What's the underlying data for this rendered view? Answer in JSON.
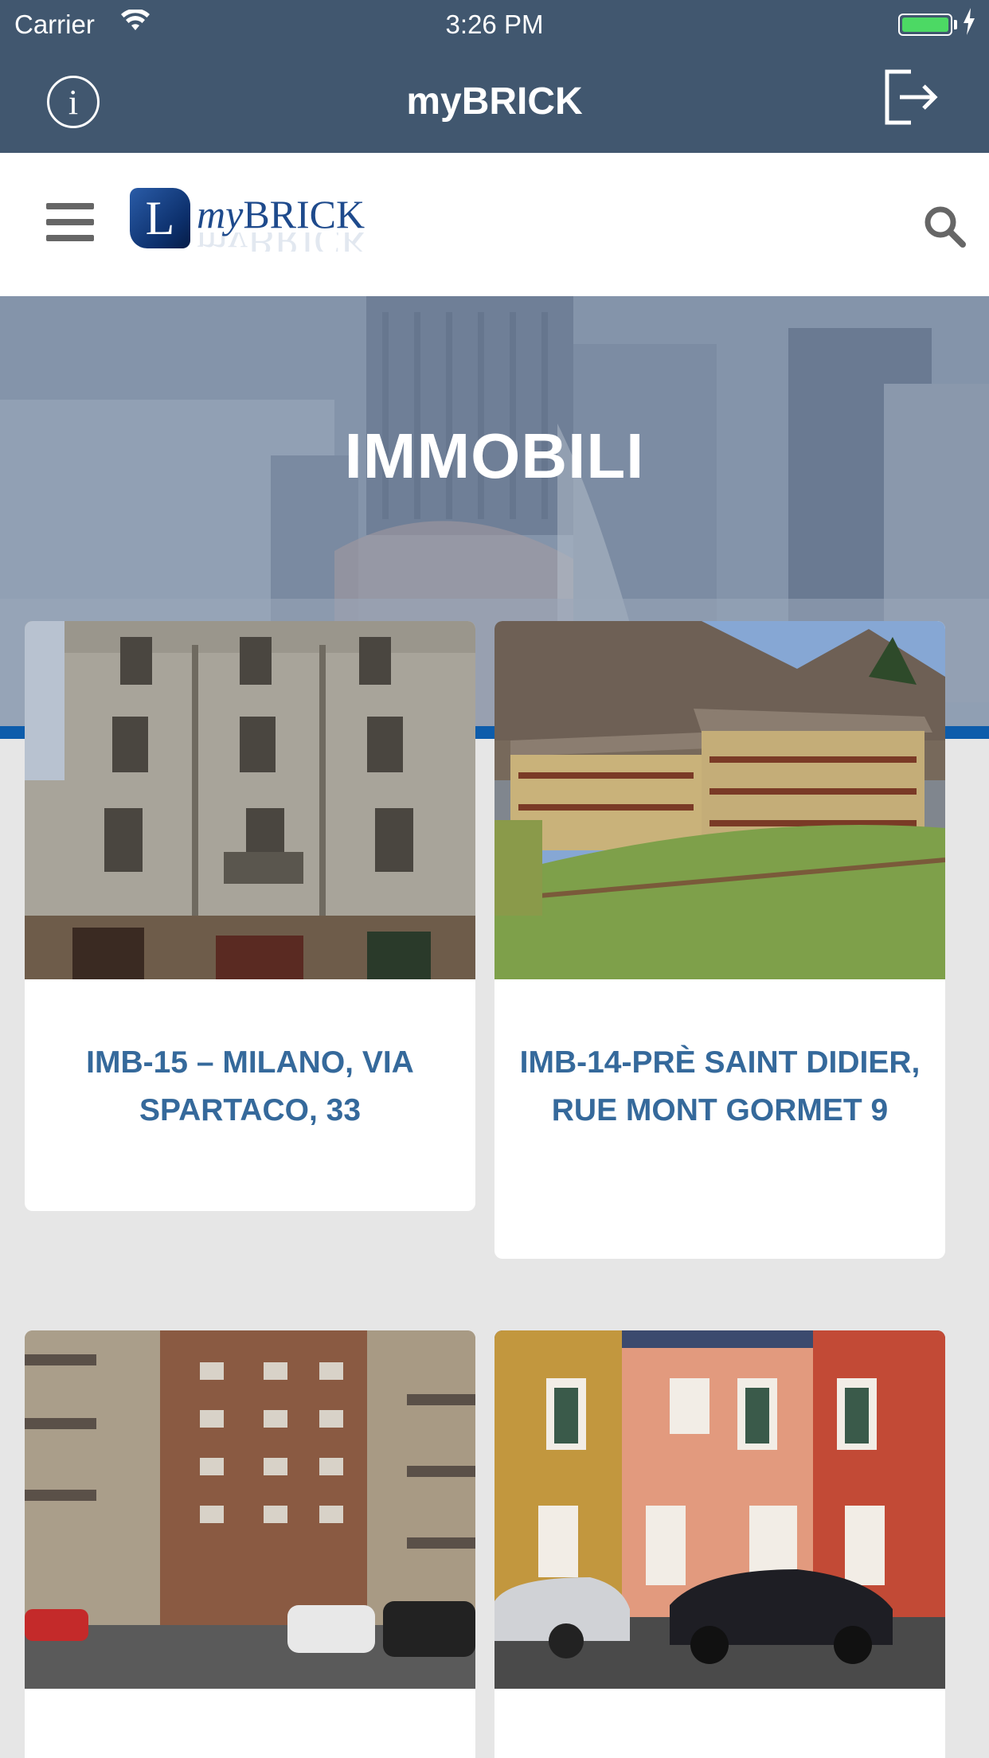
{
  "status_bar": {
    "carrier": "Carrier",
    "time": "3:26 PM",
    "battery_color": "#4cd964"
  },
  "nav_bar": {
    "title": "myBRICK",
    "info_icon": "info-circle-icon",
    "logout_icon": "logout-icon",
    "info_glyph": "i",
    "background": "#41576f"
  },
  "header": {
    "logo_mark": "L",
    "logo_text_my": "my",
    "logo_text_brick": "BRICK",
    "menu_icon": "hamburger-icon",
    "search_icon": "search-icon"
  },
  "hero": {
    "title": "IMMOBILI",
    "stripe_color": "#0d5cab"
  },
  "properties": [
    {
      "title": "IMB-15 – MILANO, VIA SPARTACO, 33",
      "photo": "grey-apartment-building-sushi-bar"
    },
    {
      "title": "IMB-14-PRÈ SAINT DIDIER, RUE MONT GORMET 9",
      "photo": "alpine-chalet-building-mountains"
    },
    {
      "title": "",
      "photo": "brick-apartment-block-parked-cars"
    },
    {
      "title": "",
      "photo": "orange-townhouses-parked-cars"
    }
  ],
  "accent_color": "#35699b"
}
